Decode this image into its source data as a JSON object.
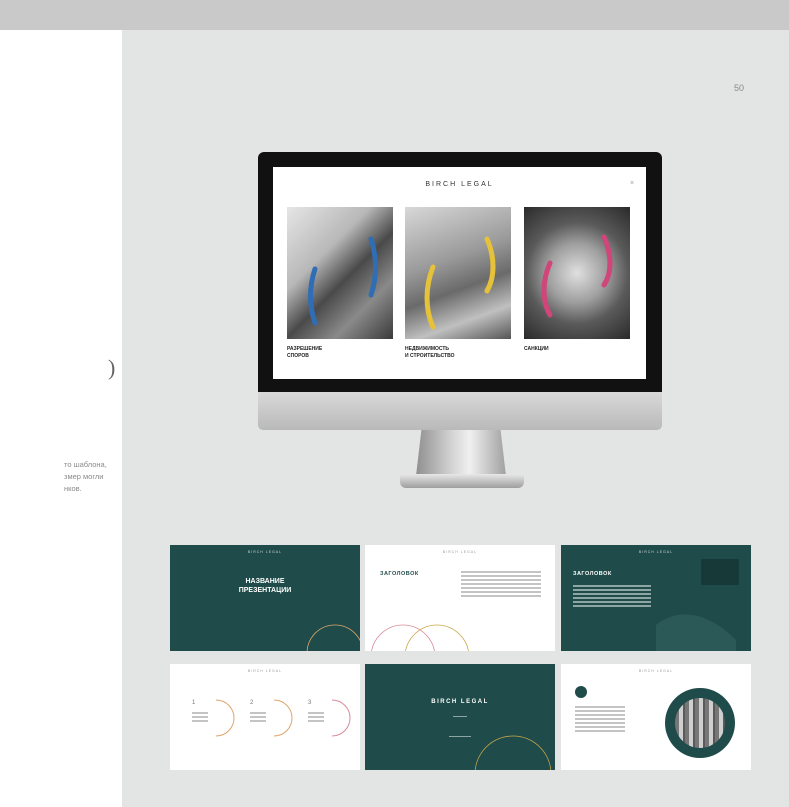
{
  "page": {
    "page_number": "50"
  },
  "left_panel": {
    "paren": ")",
    "description_lines": [
      "то шаблона,",
      "змер могли",
      "нков."
    ]
  },
  "monitor": {
    "brand": "BIRCH LEGAL",
    "close_icon": "×",
    "captions": [
      "РАЗРЕШЕНИЕ\nСПОРОВ",
      "НЕДВИЖИМОСТЬ\nИ СТРОИТЕЛЬСТВО",
      "САНКЦИИ"
    ],
    "photo_accents": [
      "#2f6db5",
      "#e5c23a",
      "#d0457a"
    ]
  },
  "slides": {
    "s1": {
      "brand": "BIRCH LEGAL",
      "title": "НАЗВАНИЕ\nПРЕЗЕНТАЦИИ"
    },
    "s2": {
      "brand": "BIRCH LEGAL",
      "heading": "ЗАГОЛОВОК"
    },
    "s3": {
      "brand": "BIRCH LEGAL",
      "heading": "ЗАГОЛОВОК"
    },
    "s4": {
      "brand": "BIRCH LEGAL",
      "numbers": [
        "1",
        "2",
        "3"
      ]
    },
    "s5": {
      "title": "BIRCH LEGAL"
    },
    "s6": {
      "brand": "BIRCH LEGAL"
    }
  },
  "colors": {
    "accent_green": "#1f4c4a",
    "arc_orange": "#e0a56a",
    "arc_pink": "#d88a9a",
    "arc_gold": "#c9a84a"
  }
}
